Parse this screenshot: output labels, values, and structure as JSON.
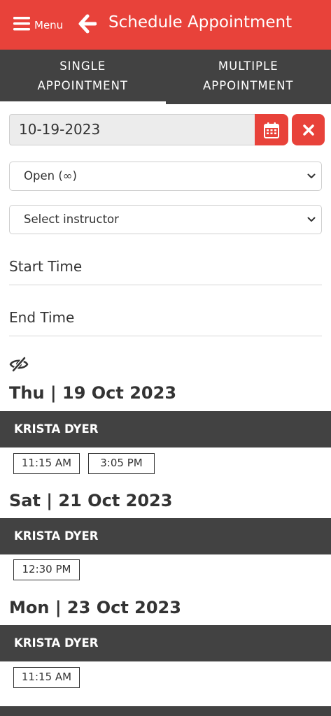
{
  "header": {
    "menu_label": "Menu",
    "title": "Schedule Appointment"
  },
  "tabs": [
    {
      "line1": "SINGLE",
      "line2": "APPOINTMENT",
      "active": true
    },
    {
      "line1": "MULTIPLE",
      "line2": "APPOINTMENT",
      "active": false
    }
  ],
  "date": {
    "value": "10-19-2023"
  },
  "selects": {
    "availability": "Open (∞)",
    "instructor": "Select instructor"
  },
  "fields": {
    "start_time": "Start Time",
    "end_time": "End Time"
  },
  "days": [
    {
      "title": "Thu | 19 Oct 2023",
      "instructor": "KRISTA DYER",
      "slots": [
        "11:15 AM",
        "3:05 PM"
      ]
    },
    {
      "title": "Sat | 21 Oct 2023",
      "instructor": "KRISTA DYER",
      "slots": [
        "12:30 PM"
      ]
    },
    {
      "title": "Mon | 23 Oct 2023",
      "instructor": "KRISTA DYER",
      "slots": [
        "11:15 AM"
      ]
    }
  ],
  "colors": {
    "accent": "#e8423a",
    "dark": "#424242"
  }
}
